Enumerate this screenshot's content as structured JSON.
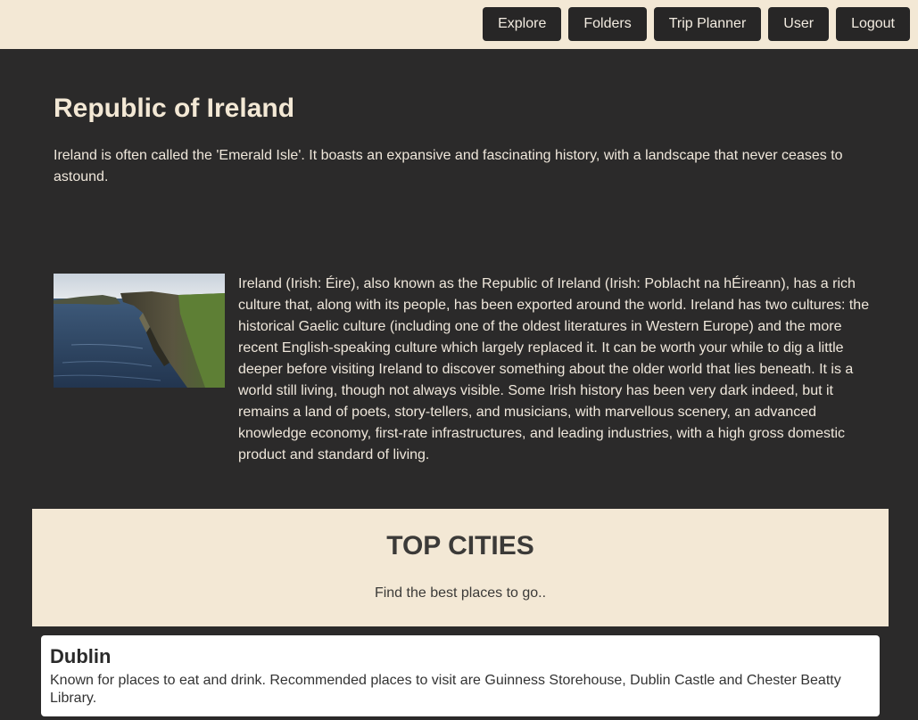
{
  "nav": {
    "items": [
      {
        "label": "Explore"
      },
      {
        "label": "Folders"
      },
      {
        "label": "Trip Planner"
      },
      {
        "label": "User"
      },
      {
        "label": "Logout"
      }
    ]
  },
  "country": {
    "title": "Republic of Ireland",
    "intro": "Ireland is often called the 'Emerald Isle'. It boasts an expansive and fascinating history, with a landscape that never ceases to astound.",
    "description": "Ireland (Irish: Éire), also known as the Republic of Ireland (Irish: Poblacht na hÉireann), has a rich culture that, along with its people, has been exported around the world. Ireland has two cultures: the historical Gaelic culture (including one of the oldest literatures in Western Europe) and the more recent English-speaking culture which largely replaced it. It can be worth your while to dig a little deeper before visiting Ireland to discover something about the older world that lies beneath. It is a world still living, though not always visible. Some Irish history has been very dark indeed, but it remains a land of poets, story-tellers, and musicians, with marvellous scenery, an advanced knowledge economy, first-rate infrastructures, and leading industries, with a high gross domestic product and standard of living."
  },
  "top_cities": {
    "title": "TOP CITIES",
    "subtitle": "Find the best places to go..",
    "cities": [
      {
        "name": "Dublin",
        "description": "Known for places to eat and drink. Recommended places to visit are Guinness Storehouse, Dublin Castle and Chester Beatty Library."
      }
    ]
  },
  "colors": {
    "page_background": "#2b2a2a",
    "header_background": "#f3e8d5",
    "button_background": "#272626",
    "card_background": "#ffffff"
  }
}
